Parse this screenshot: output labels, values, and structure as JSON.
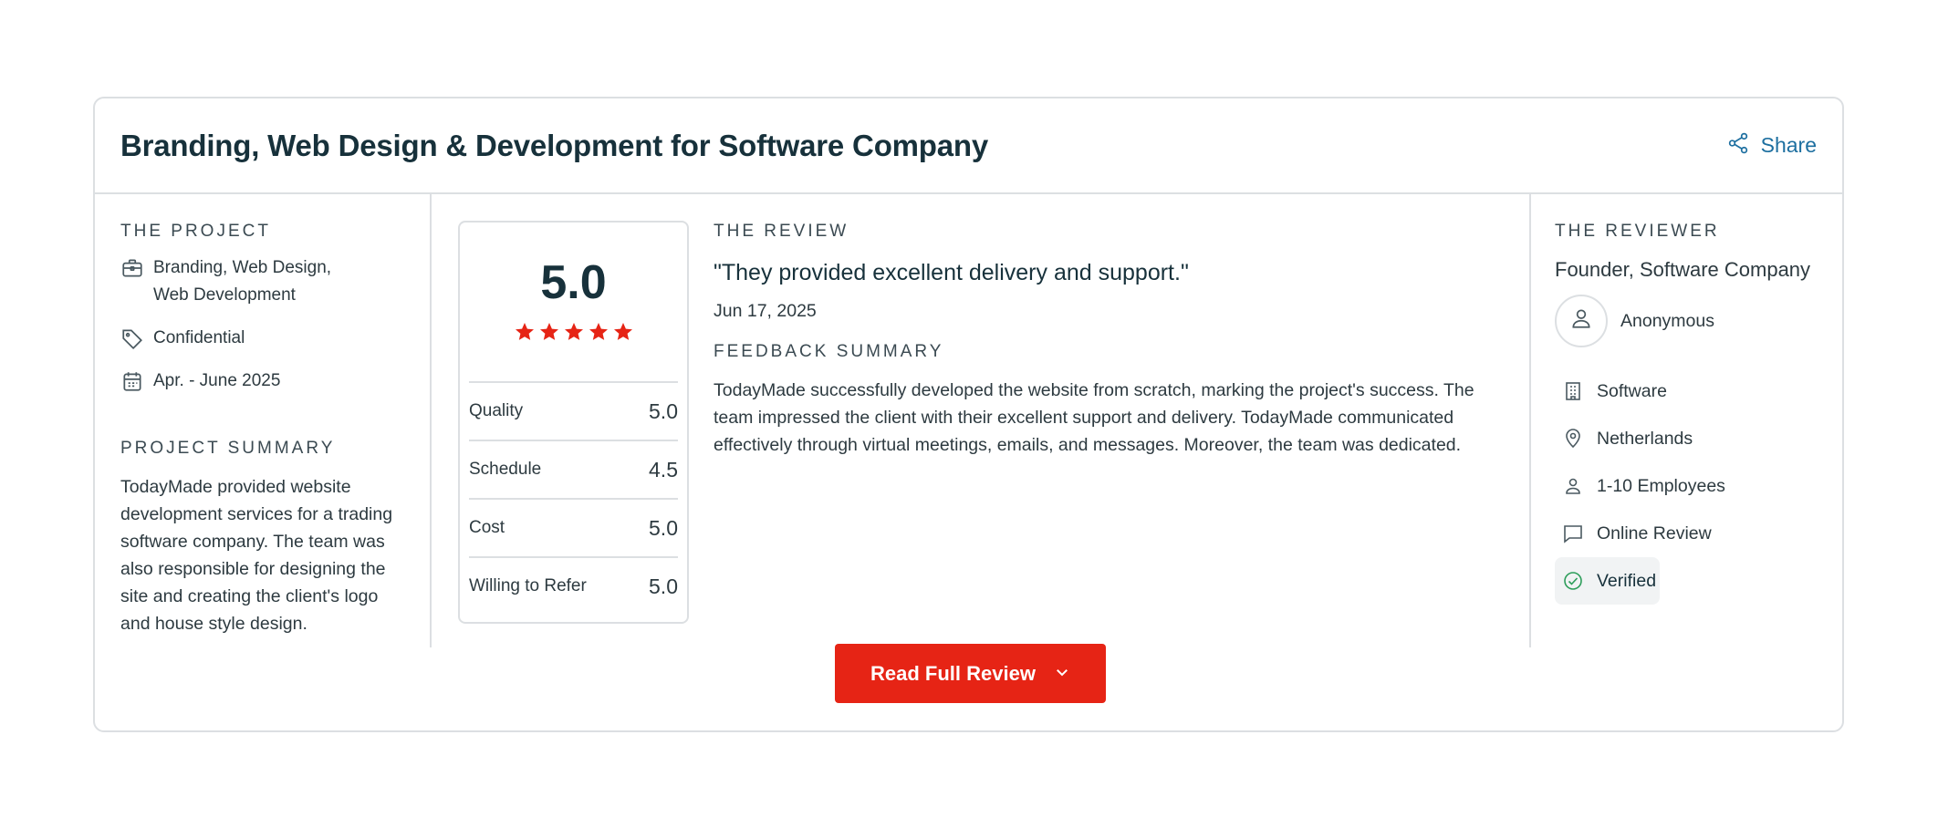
{
  "header": {
    "title": "Branding, Web Design & Development for Software Company",
    "share_label": "Share"
  },
  "project": {
    "section_label": "THE PROJECT",
    "services_line1": "Branding, Web Design,",
    "services_line2": "Web Development",
    "budget": "Confidential",
    "timeline": "Apr. - June 2025",
    "summary_label": "PROJECT SUMMARY",
    "summary": "TodayMade provided website development services for a trading software company. The team was also responsible for designing the site and creating the client's logo and house style design."
  },
  "rating": {
    "overall": "5.0",
    "stars": 5,
    "star_color": "#e62415",
    "rows": [
      {
        "label": "Quality",
        "value": "5.0"
      },
      {
        "label": "Schedule",
        "value": "4.5"
      },
      {
        "label": "Cost",
        "value": "5.0"
      },
      {
        "label": "Willing to Refer",
        "value": "5.0"
      }
    ]
  },
  "review": {
    "section_label": "THE REVIEW",
    "quote": "\"They provided excellent delivery and support.\"",
    "date": "Jun 17, 2025",
    "feedback_label": "FEEDBACK SUMMARY",
    "feedback": "TodayMade successfully developed the website from scratch, marking the project's success. The team impressed the client with their excellent support and delivery. TodayMade communicated effectively through virtual meetings, emails, and messages. Moreover, the team was dedicated."
  },
  "reviewer": {
    "section_label": "THE REVIEWER",
    "role": "Founder, Software Company",
    "name": "Anonymous",
    "industry": "Software",
    "location": "Netherlands",
    "size": "1-10 Employees",
    "review_type": "Online Review",
    "verified": "Verified"
  },
  "actions": {
    "read_full_review": "Read Full Review"
  },
  "colors": {
    "accent": "#e62415",
    "link": "#1d6fa0",
    "verified": "#2e9e5b"
  }
}
